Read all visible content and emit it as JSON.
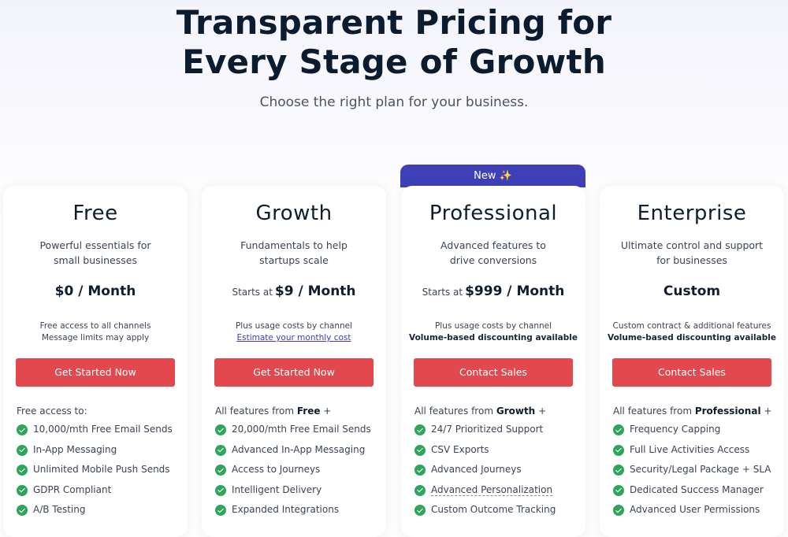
{
  "hero": {
    "title_line1": "Transparent Pricing for",
    "title_line2": "Every Stage of Growth",
    "subtitle": "Choose the right plan for your business."
  },
  "colors": {
    "accent": "#3f3fb8",
    "cta": "#e2484d",
    "check": "#2fa55c"
  },
  "badge": {
    "label": "New ✨"
  },
  "plans": [
    {
      "name": "Free",
      "desc1": "Powerful essentials for",
      "desc2": "small businesses",
      "price_prefix": "",
      "price": "$0 / Month",
      "note1": "Free access to all channels",
      "note2": "Message limits may apply",
      "cta": "Get Started Now",
      "feat_head": "Free access to:",
      "feat_head_bold": "",
      "feat_head_suffix": "",
      "features": [
        "10,000/mth Free Email Sends",
        "In-App Messaging",
        "Unlimited Mobile Push Sends",
        "GDPR Compliant",
        "A/B Testing"
      ]
    },
    {
      "name": "Growth",
      "desc1": "Fundamentals to help",
      "desc2": "startups scale",
      "price_prefix": "Starts at",
      "price": "$9 / Month",
      "note1": "Plus usage costs by channel",
      "note2": "Estimate your monthly cost",
      "cta": "Get Started Now",
      "feat_head": "All features from",
      "feat_head_bold": "Free",
      "feat_head_suffix": "+",
      "features": [
        "20,000/mth Free Email Sends",
        "Advanced In-App Messaging",
        "Access to Journeys",
        "Intelligent Delivery",
        "Expanded Integrations"
      ]
    },
    {
      "name": "Professional",
      "desc1": "Advanced features to",
      "desc2": "drive conversions",
      "price_prefix": "Starts at",
      "price": "$999 / Month",
      "note1": "Plus usage costs by channel",
      "note2": "Volume-based discounting available",
      "cta": "Contact Sales",
      "feat_head": "All features from",
      "feat_head_bold": "Growth",
      "feat_head_suffix": "+",
      "features": [
        "24/7 Prioritized Support",
        "CSV Exports",
        "Advanced Journeys",
        "Advanced Personalization",
        "Custom Outcome Tracking"
      ]
    },
    {
      "name": "Enterprise",
      "desc1": "Ultimate control and support",
      "desc2": "for businesses",
      "price_prefix": "",
      "price": "Custom",
      "note1": "Custom contract & additional features",
      "note2": "Volume-based discounting available",
      "cta": "Contact Sales",
      "feat_head": "All features from",
      "feat_head_bold": "Professional",
      "feat_head_suffix": "+",
      "features": [
        "Frequency Capping",
        "Full Live Activities Access",
        "Security/Legal Package + SLA",
        "Dedicated Success Manager",
        "Advanced User Permissions"
      ]
    }
  ]
}
